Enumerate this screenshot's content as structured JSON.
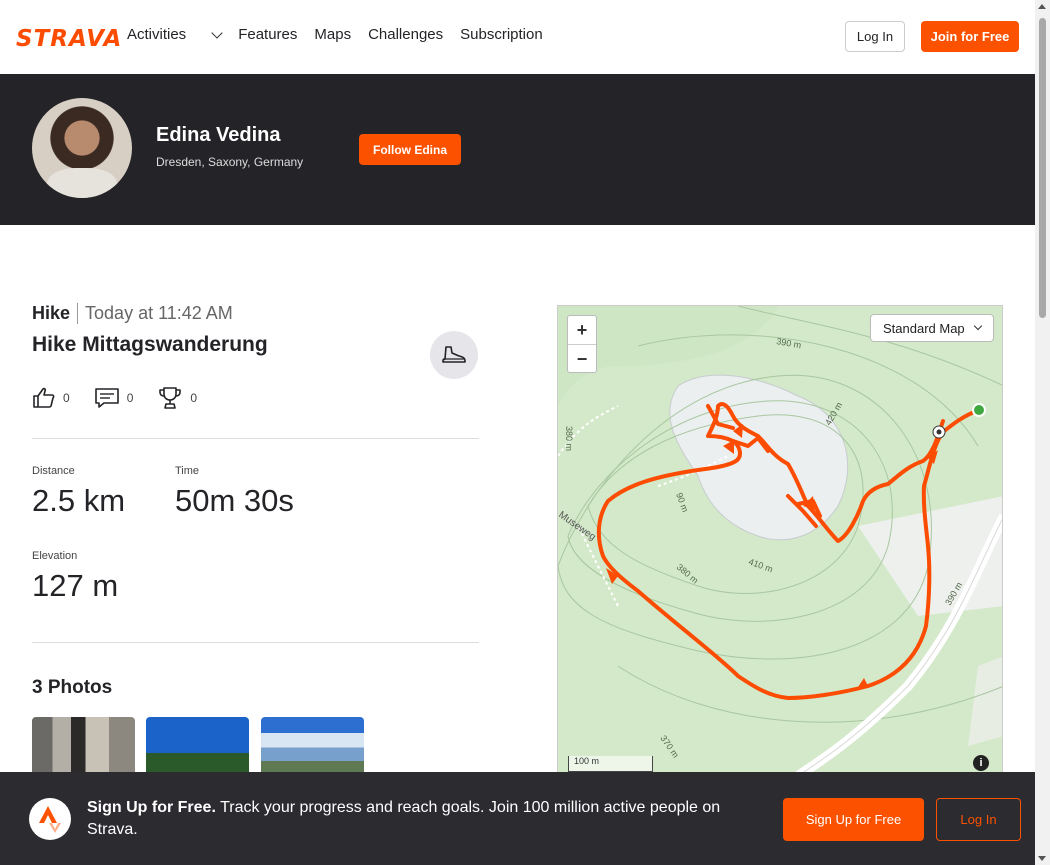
{
  "brand": {
    "logo_text": "STRAVA",
    "accent": "#fc5200",
    "dark_bg": "#242428"
  },
  "nav": {
    "items": [
      {
        "label": "Activities"
      },
      {
        "label": "Features"
      },
      {
        "label": "Maps"
      },
      {
        "label": "Challenges"
      },
      {
        "label": "Subscription"
      }
    ],
    "login_label": "Log In",
    "join_label": "Join for Free"
  },
  "profile": {
    "name": "Edina Vedina",
    "location": "Dresden, Saxony, Germany",
    "follow_label": "Follow Edina"
  },
  "activity": {
    "type": "Hike",
    "time": "Today at 11:42 AM",
    "title": "Hike Mittagswanderung",
    "kudos_count": "0",
    "comments_count": "0",
    "achievements_count": "0",
    "stats": {
      "distance_label": "Distance",
      "distance_value": "2.5 km",
      "time_label": "Time",
      "time_value": "50m 30s",
      "elevation_label": "Elevation",
      "elevation_value": "127 m"
    },
    "photos_title": "3 Photos"
  },
  "map": {
    "style_label": "Standard Map",
    "zoom_in": "+",
    "zoom_out": "−",
    "scale_label": "100 m",
    "info_icon": "i",
    "contour_labels": [
      "390 m",
      "420 m",
      "410 m",
      "390 m",
      "380 m",
      "380 m",
      "370 m",
      "90 m"
    ],
    "street_label": "Museweg",
    "route_color": "#fc4c02"
  },
  "banner": {
    "bold": "Sign Up for Free.",
    "text": "Track your progress and reach goals. Join 100 million active people on Strava.",
    "signup_label": "Sign Up for Free",
    "login_label": "Log In"
  }
}
